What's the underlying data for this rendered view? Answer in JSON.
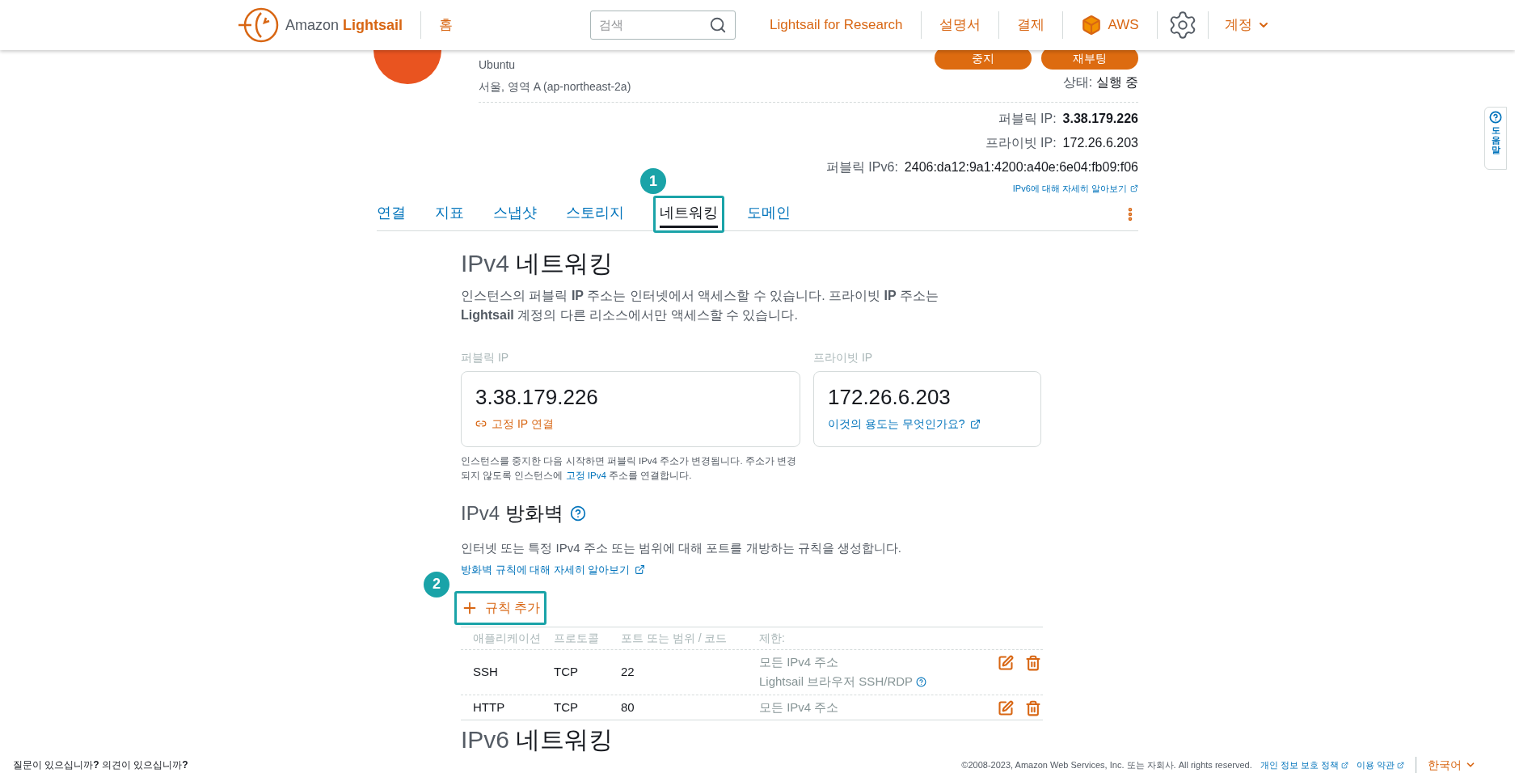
{
  "header": {
    "brand_prefix": "Amazon",
    "brand_name": "Lightsail",
    "home": "홈",
    "search": {
      "placeholder": "검색"
    },
    "links": [
      "Lightsail for Research",
      "설명서",
      "결제"
    ],
    "aws": "AWS",
    "account": "계정"
  },
  "instance": {
    "os": "Ubuntu",
    "location": "서울, 영역 A (ap-northeast-2a)",
    "buttons": [
      "중지",
      "재부팅"
    ],
    "status_label": "상태:",
    "status": "실행 중",
    "ips": [
      {
        "label": "퍼블릭 IP:",
        "value": "3.38.179.226",
        "bold": true
      },
      {
        "label": "프라이빗 IP:",
        "value": "172.26.6.203",
        "bold": false
      },
      {
        "label": "퍼블릭 IPv6:",
        "value": "2406:da12:9a1:4200:a40e:6e04:fb09:f06",
        "bold": false
      }
    ],
    "ipv6_link": "IPv6에 대해 자세히 알아보기"
  },
  "tabs": [
    {
      "label": "연결",
      "selected": false
    },
    {
      "label": "지표",
      "selected": false
    },
    {
      "label": "스냅샷",
      "selected": false
    },
    {
      "label": "스토리지",
      "selected": false
    },
    {
      "label": "네트워킹",
      "selected": true,
      "callout": "1"
    },
    {
      "label": "도메인",
      "selected": false
    }
  ],
  "ipv4": {
    "title_prefix": "IPv4",
    "title": "네트워킹",
    "description": "인스턴스의 퍼블릭 **IP** 주소는 인터넷에서 액세스할 수 있습니다. 프라이빗 **IP** 주소는 **Lightsail** 계정의 다른 리소스에서만 액세스할 수 있습니다.",
    "public": {
      "label": "퍼블릭 IP",
      "value": "3.38.179.226",
      "link": "고정 IP 연결"
    },
    "private": {
      "label": "프라이빗 IP",
      "value": "172.26.6.203",
      "link": "이것의 용도는 무엇인가요?"
    },
    "note_before": "인스턴스를 중지한 다음 시작하면 퍼블릭 IPv4 주소가 변경됩니다. 주소가 변경되지 않도록 인스턴스에",
    "note_link": "고정 IPv4",
    "note_after": "주소를 연결합니다."
  },
  "firewall": {
    "title_prefix": "IPv4",
    "title": "방화벽",
    "description": "인터넷 또는 특정 IPv4 주소 또는 범위에 대해 포트를 개방하는 규칙을 생성합니다.",
    "link": "방화벽 규칙에 대해 자세히 알아보기",
    "add_rule": {
      "label": "규칙 추가",
      "callout": "2"
    },
    "columns": [
      "애플리케이션",
      "프로토콜",
      "포트 또는 범위 / 코드",
      "제한:"
    ],
    "rows": [
      {
        "application": "SSH",
        "protocol": "TCP",
        "port": "22",
        "restrictions": [
          {
            "text": "모든 IPv4 주소",
            "help": false
          },
          {
            "text": "Lightsail 브라우저 SSH/RDP",
            "help": true
          }
        ]
      },
      {
        "application": "HTTP",
        "protocol": "TCP",
        "port": "80",
        "restrictions": [
          {
            "text": "모든 IPv4 주소",
            "help": false
          }
        ]
      }
    ]
  },
  "ipv6": {
    "title_prefix": "IPv6",
    "title": "네트워킹"
  },
  "help_tab": "도움말",
  "footer": {
    "feedback": "질문이 있으십니까**?** 의견이 있으십니까**?**",
    "copyright": "©2008-2023, Amazon Web Services, Inc. 또는 자회사. All rights reserved.",
    "links": [
      "개인 정보 보호 정책",
      "이용 약관"
    ],
    "language": "한국어"
  }
}
